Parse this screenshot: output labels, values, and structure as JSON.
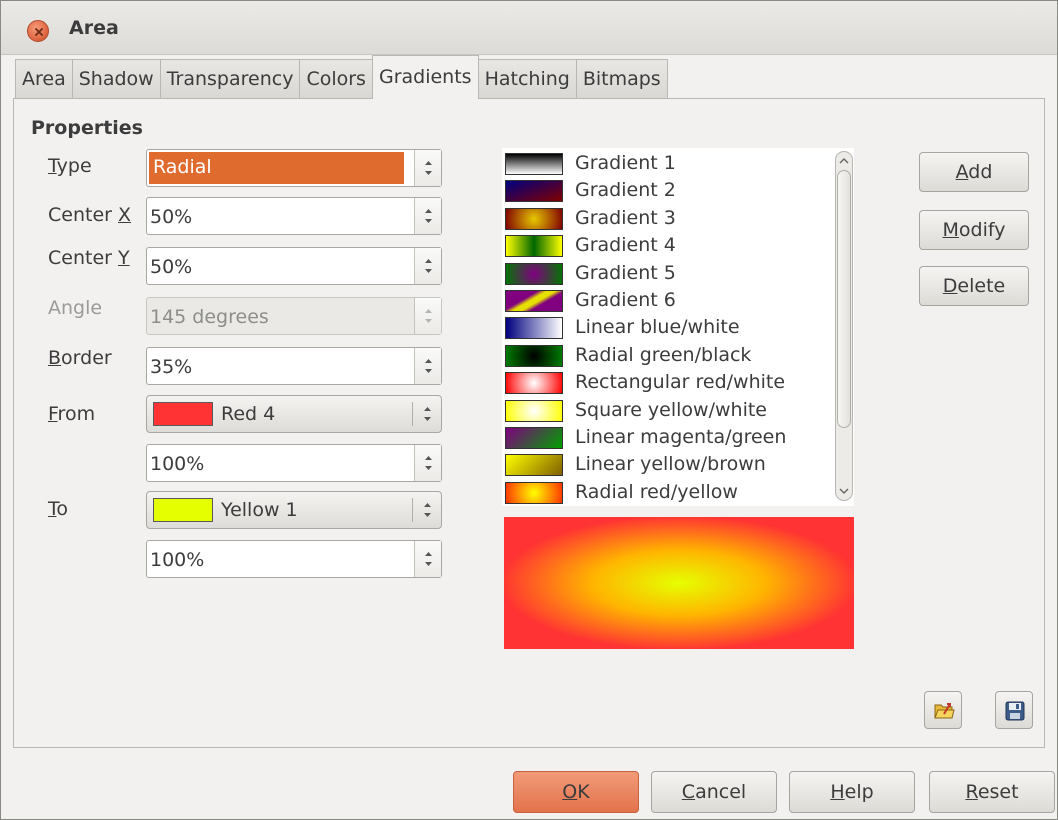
{
  "window": {
    "title": "Area"
  },
  "tabs": [
    "Area",
    "Shadow",
    "Transparency",
    "Colors",
    "Gradients",
    "Hatching",
    "Bitmaps"
  ],
  "active_tab": "Gradients",
  "properties": {
    "section_title": "Properties",
    "type": {
      "label_pre": "",
      "label_ul": "T",
      "label_post": "ype",
      "value": "Radial"
    },
    "center_x": {
      "label_pre": "Center ",
      "label_ul": "X",
      "label_post": "",
      "value": "50%"
    },
    "center_y": {
      "label_pre": "Center ",
      "label_ul": "Y",
      "label_post": "",
      "value": "50%"
    },
    "angle": {
      "label_pre": "An",
      "label_ul": "g",
      "label_post": "le",
      "value": "145 degrees",
      "disabled": true
    },
    "border": {
      "label_pre": "",
      "label_ul": "B",
      "label_post": "order",
      "value": "35%"
    },
    "from": {
      "label_pre": "",
      "label_ul": "F",
      "label_post": "rom",
      "color_name": "Red 4",
      "color": "#ff3333",
      "intensity": "100%"
    },
    "to": {
      "label_pre": "",
      "label_ul": "T",
      "label_post": "o",
      "color_name": "Yellow 1",
      "color": "#e6ff00",
      "intensity": "100%"
    }
  },
  "gradients": [
    {
      "name": "Gradient 1",
      "swatch": "linear-gradient(180deg,#000,#fff)"
    },
    {
      "name": "Gradient 2",
      "swatch": "linear-gradient(160deg,#000080,#800000)"
    },
    {
      "name": "Gradient 3",
      "swatch": "radial-gradient(circle,#e6c800,#800000)"
    },
    {
      "name": "Gradient 4",
      "swatch": "linear-gradient(90deg,#ffff00,#006600,#ffff00)"
    },
    {
      "name": "Gradient 5",
      "swatch": "radial-gradient(circle,#800080,#007700)"
    },
    {
      "name": "Gradient 6",
      "swatch": "linear-gradient(150deg,#800080 35%,#e6e000 45%,#e6e000 55%,#800080 65%)"
    },
    {
      "name": "Linear blue/white",
      "swatch": "linear-gradient(90deg,#000080,#ffffff)"
    },
    {
      "name": "Radial green/black",
      "swatch": "radial-gradient(circle,#000000,#008000)"
    },
    {
      "name": "Rectangular red/white",
      "swatch": "radial-gradient(circle,#ffffff,#ff0000)"
    },
    {
      "name": "Square yellow/white",
      "swatch": "radial-gradient(circle,#ffffff,#ffff00)"
    },
    {
      "name": "Linear magenta/green",
      "swatch": "linear-gradient(135deg,#800080,#00a000)"
    },
    {
      "name": "Linear yellow/brown",
      "swatch": "linear-gradient(135deg,#ffff00,#806000)"
    },
    {
      "name": "Radial red/yellow",
      "swatch": "radial-gradient(circle,#ffff00,#ff3300)"
    }
  ],
  "buttons": {
    "add": {
      "pre": "",
      "ul": "A",
      "post": "dd"
    },
    "modify": {
      "pre": "",
      "ul": "M",
      "post": "odify"
    },
    "delete": {
      "pre": "",
      "ul": "D",
      "post": "elete"
    },
    "ok": {
      "pre": "",
      "ul": "O",
      "post": "K"
    },
    "cancel": {
      "pre": "",
      "ul": "C",
      "post": "ancel"
    },
    "help": {
      "pre": "",
      "ul": "H",
      "post": "elp"
    },
    "reset": {
      "pre": "",
      "ul": "R",
      "post": "eset"
    }
  },
  "icons": {
    "load": "open-folder-icon",
    "save": "save-disk-icon"
  },
  "colors": {
    "accent": "#e06b2f",
    "ok_button": "#e2734c"
  }
}
